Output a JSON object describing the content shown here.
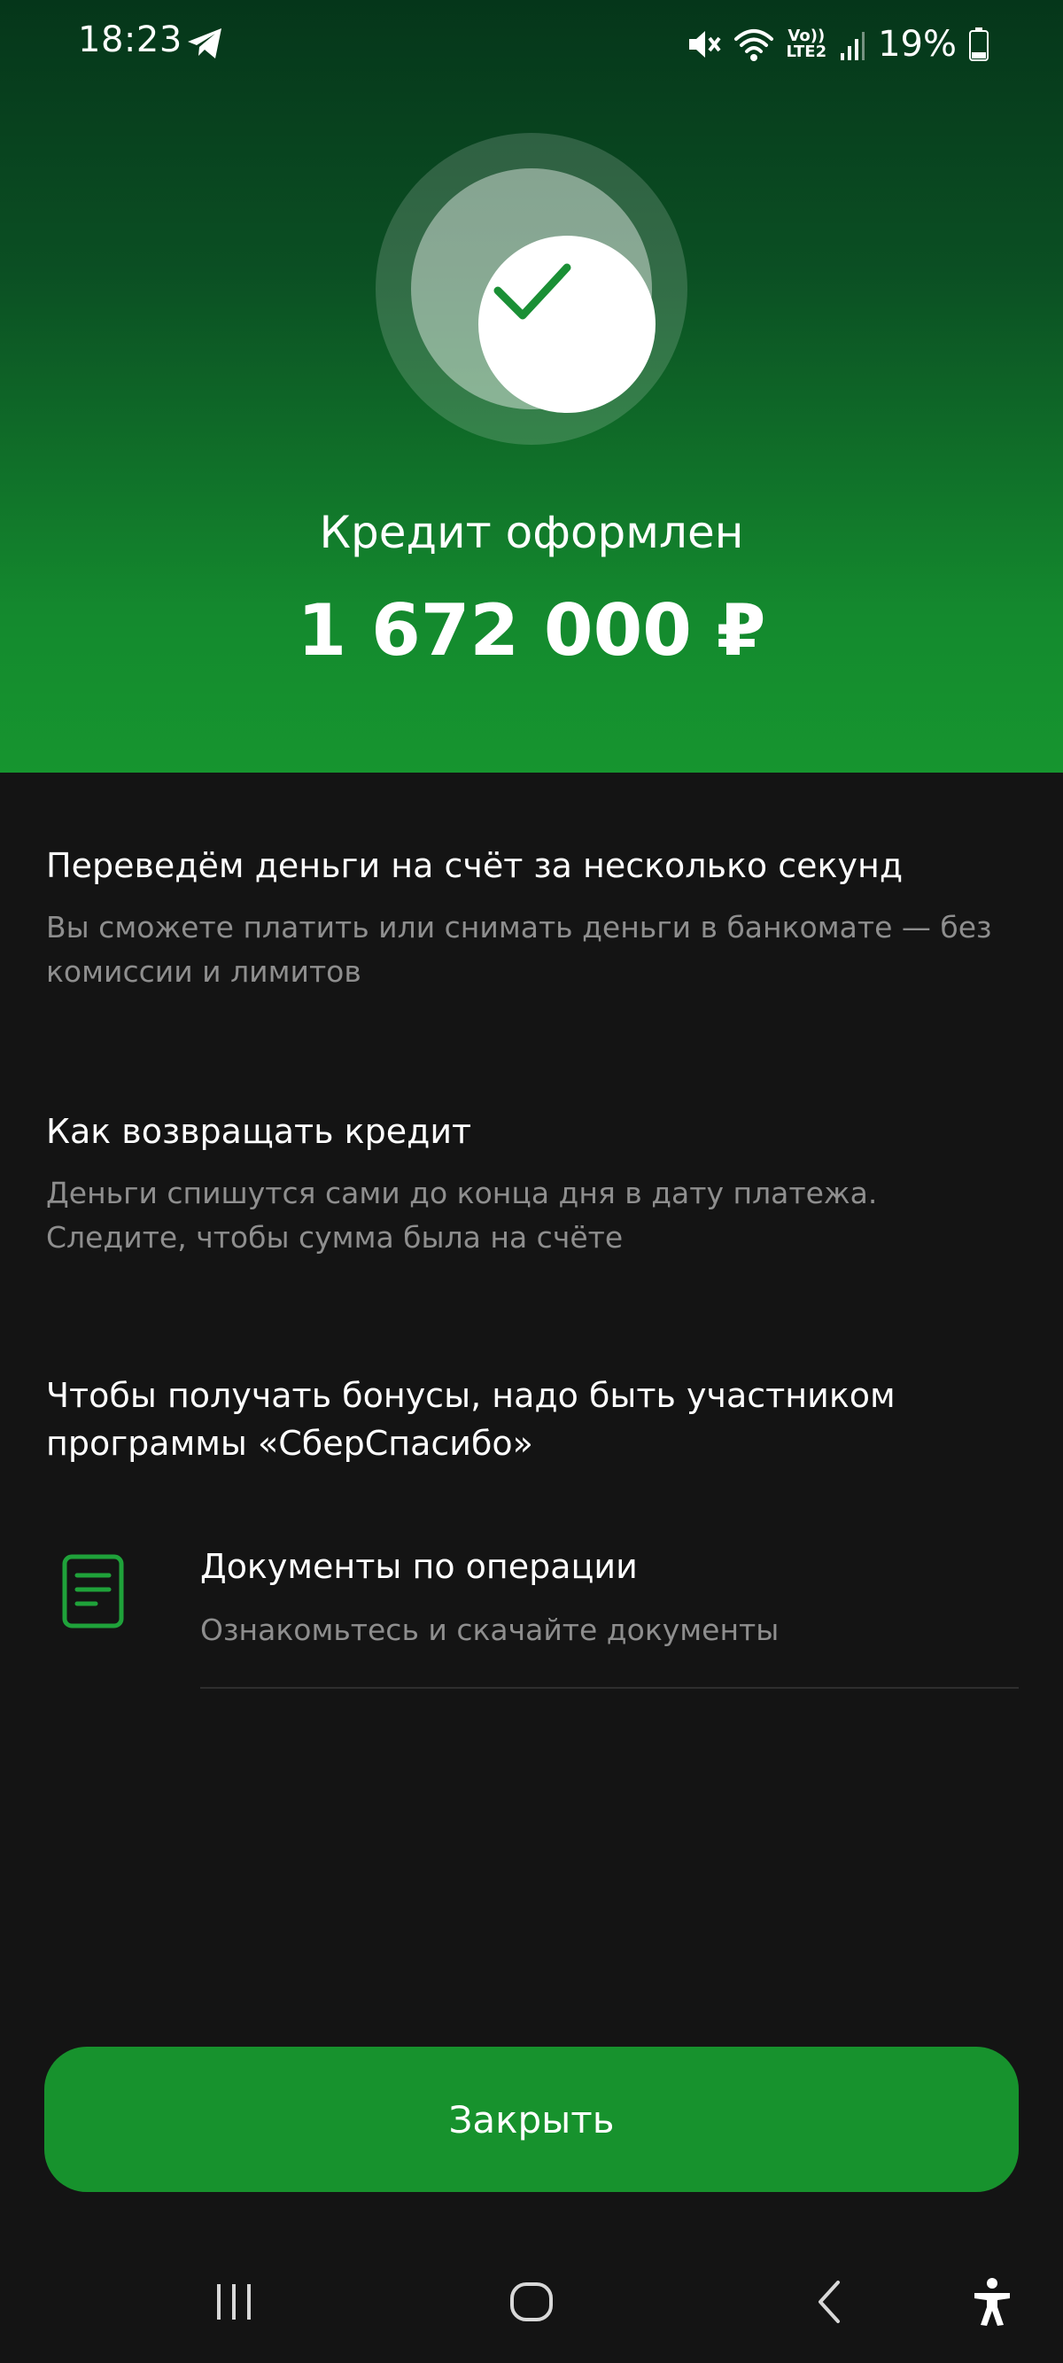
{
  "status_bar": {
    "time": "18:23",
    "network_label_top": "Vo))",
    "network_label_bottom": "LTE2",
    "battery": "19%"
  },
  "hero": {
    "title": "Кредит оформлен",
    "amount": "1 672 000 ₽"
  },
  "sections": [
    {
      "title": "Переведём деньги на счёт за несколько секунд",
      "text": "Вы сможете платить или снимать деньги в банкомате — без комиссии и лимитов"
    },
    {
      "title": "Как возвращать кредит",
      "text": "Деньги спишутся сами до конца дня в дату платежа. Следите, чтобы сумма была на счёте"
    },
    {
      "title": "Чтобы получать бонусы, надо быть участником программы «СберСпасибо»"
    }
  ],
  "documents": {
    "title": "Документы по операции",
    "subtitle": "Ознакомьтесь и скачайте документы"
  },
  "close_button": {
    "label": "Закрыть"
  },
  "icons": {
    "status": [
      "telegram-icon",
      "mute-icon",
      "wifi-icon",
      "signal-icon",
      "battery-icon"
    ],
    "badge": "checkmark-icon",
    "documents": "document-icon",
    "nav": [
      "recent-apps-icon",
      "home-icon",
      "back-icon",
      "accessibility-icon"
    ]
  },
  "colors": {
    "accent_green": "#17922D",
    "check_green": "#1A8F35",
    "background": "#141414",
    "secondary_text": "#8E8E8E"
  }
}
